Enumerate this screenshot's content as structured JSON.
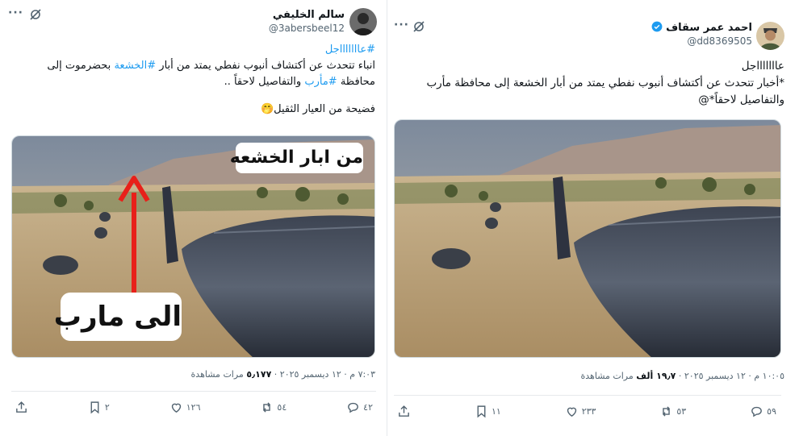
{
  "left_post": {
    "author_name": "سالم الخليفي",
    "handle": "@3abersbeel12",
    "line_1": "#عاااااااجل",
    "line_2": "انباء تتحدث عن أكتشاف أنبوب نفطي يمتد من أبار",
    "line_2_tag": "#الخشعة",
    "line_2_end": "بحضرموت إلى",
    "line_3_start": "محافظة",
    "line_3_tag": "#مأرب",
    "line_3_end": "والتفاصيل لاحقاً ..",
    "line_4": "فضيحة من العيار الثقيل🤭",
    "image_label_top": "من ابار الخشعه",
    "image_label_bottom": "الى مارب",
    "meta_time": "٧:٠٣ م · ١٢ ديسمبر ٢٠٢٥ · ",
    "meta_views_count": "٥٫١٧٧",
    "meta_views_label": "مرات مشاهدة",
    "replies": "٤٢",
    "reposts": "٥٤",
    "likes": "١٢٦",
    "bookmarks": "٢"
  },
  "right_post": {
    "author_name": "احمد عمر سقاف",
    "handle": "@dd8369505",
    "line_1": "عاااااااجل",
    "line_2": "*أخبار تتحدث عن أكتشاف أنبوب نفطي يمتد من أبار الخشعة إلى محافظة مأرب",
    "line_3": "والتفاصيل لاحقاً*@",
    "meta_time": "١٠:٠٥ م · ١٢ ديسمبر ٢٠٢٥ · ",
    "meta_views_count": "١٩٫٧ ألف",
    "meta_views_label": "مرات مشاهدة",
    "replies": "٥٩",
    "reposts": "٥٣",
    "likes": "٢٣٣",
    "bookmarks": "١١"
  },
  "icons": {
    "more": "more-icon",
    "grok": "grok-slash-icon",
    "verified": "verified-badge-icon",
    "reply": "reply-icon",
    "repost": "repost-icon",
    "like": "heart-icon",
    "bookmark": "bookmark-icon",
    "share": "share-icon"
  },
  "colors": {
    "accent": "#1d9bf0",
    "text": "#0f1419",
    "muted": "#536471",
    "arrow": "#e8201a"
  }
}
